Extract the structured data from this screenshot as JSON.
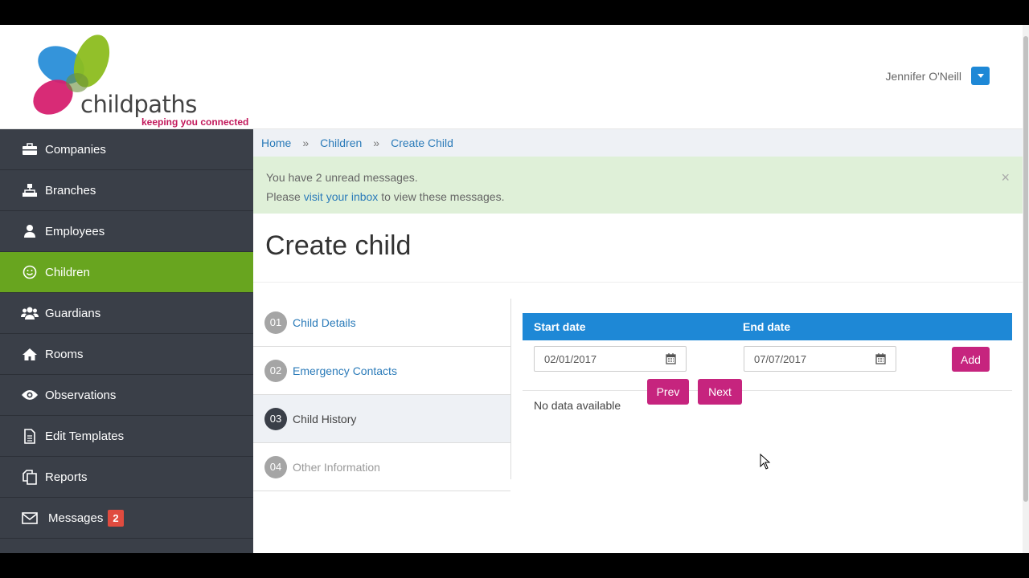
{
  "brand": {
    "name": "childpaths",
    "tagline": "keeping you connected"
  },
  "user": {
    "name": "Jennifer O'Neill"
  },
  "sidebar": {
    "items": [
      {
        "label": "Companies",
        "icon": "briefcase-icon"
      },
      {
        "label": "Branches",
        "icon": "sitemap-icon"
      },
      {
        "label": "Employees",
        "icon": "user-icon"
      },
      {
        "label": "Children",
        "icon": "smile-icon",
        "active": true
      },
      {
        "label": "Guardians",
        "icon": "users-icon"
      },
      {
        "label": "Rooms",
        "icon": "home-icon"
      },
      {
        "label": "Observations",
        "icon": "eye-icon"
      },
      {
        "label": "Edit Templates",
        "icon": "document-icon"
      },
      {
        "label": "Reports",
        "icon": "copy-icon"
      },
      {
        "label": "Messages",
        "icon": "envelope-icon",
        "badge": "2"
      }
    ]
  },
  "breadcrumb": {
    "items": [
      "Home",
      "Children",
      "Create Child"
    ],
    "separator": "»"
  },
  "alert": {
    "line1": "You have 2 unread messages.",
    "line2_prefix": "Please",
    "line2_link": "visit your inbox",
    "line2_suffix": "to view these messages.",
    "close": "×"
  },
  "page": {
    "title": "Create child"
  },
  "steps": [
    {
      "num": "01",
      "label": "Child Details",
      "state": "done"
    },
    {
      "num": "02",
      "label": "Emergency Contacts",
      "state": "done"
    },
    {
      "num": "03",
      "label": "Child History",
      "state": "current"
    },
    {
      "num": "04",
      "label": "Other Information",
      "state": "disabled"
    }
  ],
  "history": {
    "columns": [
      "Start date",
      "End date"
    ],
    "start_date": "02/01/2017",
    "end_date": "07/07/2017",
    "add_label": "Add",
    "empty_text": "No data available"
  },
  "pager": {
    "prev": "Prev",
    "next": "Next"
  },
  "colors": {
    "sidebar_bg": "#3a3f48",
    "active_green": "#68a51f",
    "primary_blue": "#1e88d6",
    "accent_pink": "#c6247e",
    "alert_bg": "#dff0d8",
    "badge_red": "#e04b3f"
  }
}
